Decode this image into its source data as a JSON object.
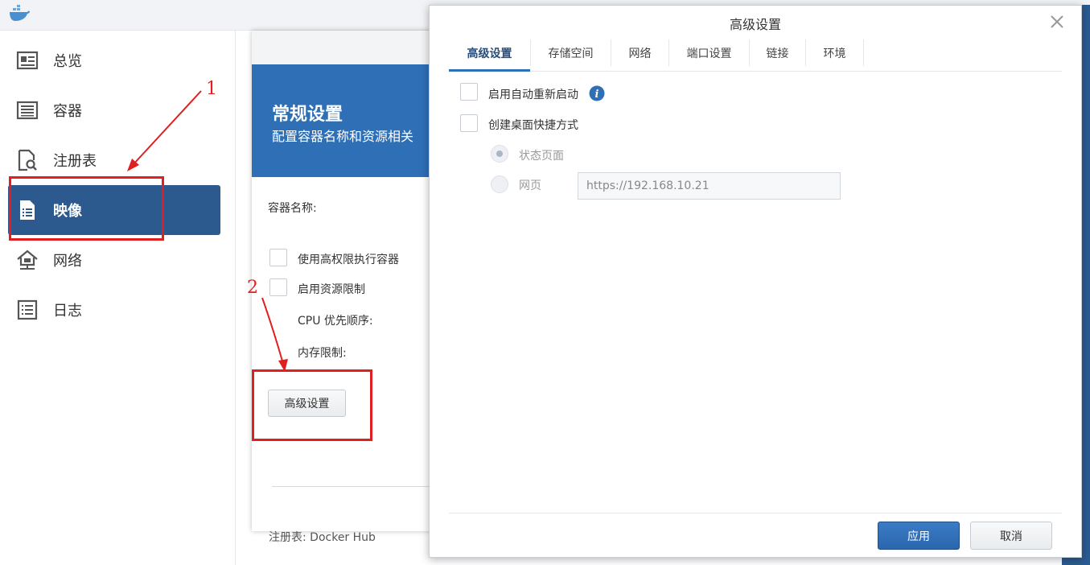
{
  "app": {
    "logo_icon": "docker-whale-icon"
  },
  "sidebar": {
    "items": [
      {
        "label": "总览",
        "icon": "overview-card-icon"
      },
      {
        "label": "容器",
        "icon": "container-list-icon"
      },
      {
        "label": "注册表",
        "icon": "registry-search-icon"
      },
      {
        "label": "映像",
        "icon": "image-file-icon",
        "active": true
      },
      {
        "label": "网络",
        "icon": "network-house-icon"
      },
      {
        "label": "日志",
        "icon": "log-list-icon"
      }
    ]
  },
  "wizard": {
    "title": "常规设置",
    "subtitle": "配置容器名称和资源相关",
    "container_name_label": "容器名称:",
    "privileged_label": "使用高权限执行容器",
    "resource_limit_label": "启用资源限制",
    "cpu_priority_label": "CPU 优先顺序:",
    "memory_limit_label": "内存限制:",
    "advanced_button": "高级设置",
    "registry_text": "注册表: Docker Hub"
  },
  "annotations": {
    "step1": "1",
    "step2": "2",
    "color": "#e02020"
  },
  "dialog": {
    "title": "高级设置",
    "tabs": [
      {
        "label": "高级设置",
        "active": true
      },
      {
        "label": "存储空间"
      },
      {
        "label": "网络"
      },
      {
        "label": "端口设置"
      },
      {
        "label": "链接"
      },
      {
        "label": "环境"
      }
    ],
    "auto_restart_label": "启用自动重新启动",
    "desktop_shortcut_label": "创建桌面快捷方式",
    "status_page_label": "状态页面",
    "web_page_label": "网页",
    "url_value": "https://192.168.10.21",
    "apply_button": "应用",
    "cancel_button": "取消"
  },
  "colors": {
    "accent": "#2f6fb6",
    "sidebar_active": "#2c5a8e",
    "annotation": "#e02020"
  }
}
